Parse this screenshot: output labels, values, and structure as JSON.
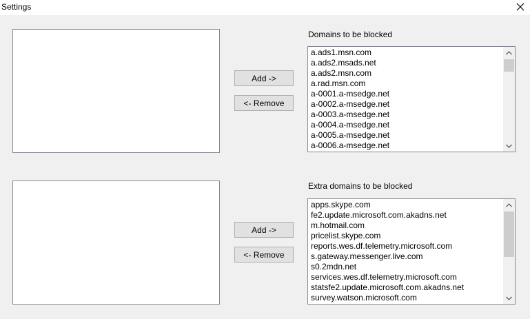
{
  "window": {
    "title": "Settings"
  },
  "section1": {
    "label": "Domains to be blocked",
    "add_label": "Add ->",
    "remove_label": "<- Remove",
    "items": [
      "a.ads1.msn.com",
      "a.ads2.msads.net",
      "a.ads2.msn.com",
      "a.rad.msn.com",
      "a-0001.a-msedge.net",
      "a-0002.a-msedge.net",
      "a-0003.a-msedge.net",
      "a-0004.a-msedge.net",
      "a-0005.a-msedge.net",
      "a-0006.a-msedge.net"
    ]
  },
  "section2": {
    "label": "Extra domains to be blocked",
    "add_label": "Add ->",
    "remove_label": "<- Remove",
    "items": [
      "apps.skype.com",
      "fe2.update.microsoft.com.akadns.net",
      "m.hotmail.com",
      "pricelist.skype.com",
      "reports.wes.df.telemetry.microsoft.com",
      "s.gateway.messenger.live.com",
      "s0.2mdn.net",
      "services.wes.df.telemetry.microsoft.com",
      "statsfe2.update.microsoft.com.akadns.net",
      "survey.watson.microsoft.com"
    ]
  },
  "icons": {
    "close": "close-icon",
    "scroll_up": "chevron-up-icon",
    "scroll_down": "chevron-down-icon"
  }
}
